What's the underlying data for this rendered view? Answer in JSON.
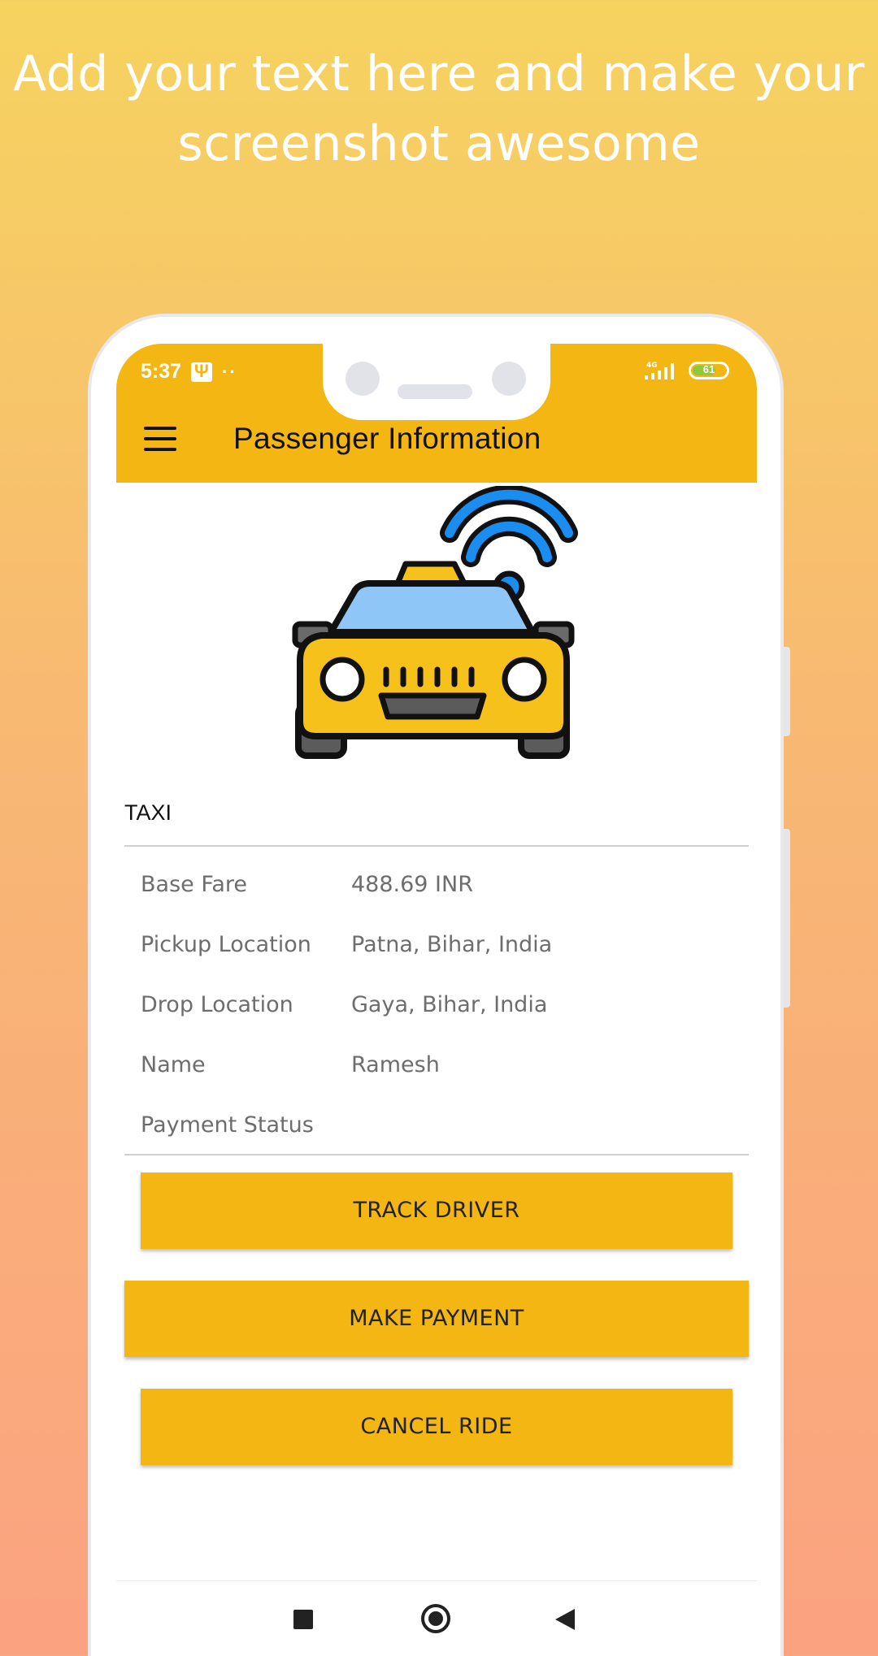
{
  "promo": {
    "headline_line1": "Add your text here and make your",
    "headline_line2": "screenshot awesome"
  },
  "status_bar": {
    "time": "5:37",
    "dots": "··",
    "network": "4G",
    "battery": "61"
  },
  "app_bar": {
    "title": "Passenger Information",
    "menu_icon": "hamburger-menu-icon"
  },
  "illustration": {
    "icon": "connected-taxi-icon",
    "colors": {
      "body": "#f7c11b",
      "glass": "#8ec6f8",
      "wifi": "#1a8ef0",
      "outline": "#111111"
    }
  },
  "ride": {
    "service_type": "TAXI",
    "details": [
      {
        "label": "Base Fare",
        "value": "488.69 INR"
      },
      {
        "label": "Pickup Location",
        "value": "Patna, Bihar, India"
      },
      {
        "label": "Drop Location",
        "value": "Gaya, Bihar, India"
      },
      {
        "label": "Name",
        "value": "Ramesh"
      },
      {
        "label": "Payment Status",
        "value": ""
      }
    ]
  },
  "actions": {
    "track_driver": "TRACK DRIVER",
    "make_payment": "MAKE PAYMENT",
    "cancel_ride": "CANCEL RIDE"
  },
  "nav_bar": {
    "recents_icon": "square-icon",
    "home_icon": "circle-icon",
    "back_icon": "triangle-back-icon"
  },
  "theme": {
    "accent": "#f3b612",
    "background_top": "#f6d35f",
    "background_bottom": "#fba281"
  }
}
